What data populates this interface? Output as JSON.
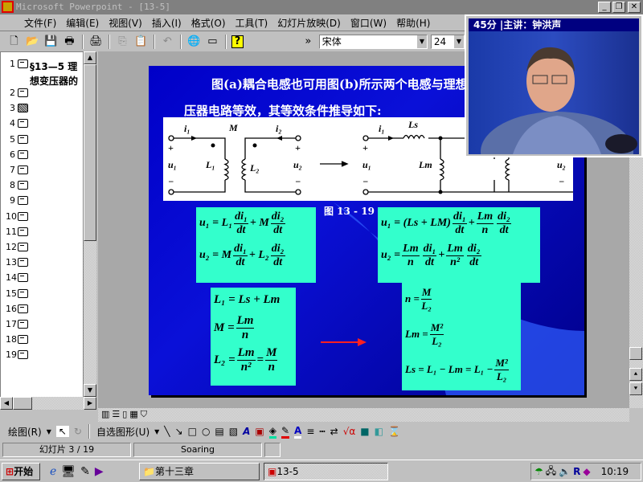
{
  "window": {
    "title": "Microsoft Powerpoint - [13-5]",
    "min": "_",
    "restore": "❐",
    "close": "✕"
  },
  "menu": [
    "文件(F)",
    "编辑(E)",
    "视图(V)",
    "插入(I)",
    "格式(O)",
    "工具(T)",
    "幻灯片放映(D)",
    "窗口(W)",
    "帮助(H)"
  ],
  "toolbar": {
    "font": "宋体",
    "size": "24",
    "more": "»"
  },
  "outline": {
    "items": [
      "1",
      "2",
      "3",
      "4",
      "5",
      "6",
      "7",
      "8",
      "9",
      "10",
      "11",
      "12",
      "13",
      "14",
      "15",
      "16",
      "17",
      "18",
      "19"
    ],
    "first_line1": "§13—5 理",
    "first_line2": "想变压器的",
    "selected": "3"
  },
  "slide": {
    "title_line1": "图(a)耦合电感也可用图(b)所示两个电感与理想变",
    "title_line2": "压器电路等效，其等效条件推导如下:",
    "caption": "图 13 - 19",
    "diagram": {
      "i1": "i₁",
      "i2": "i₂",
      "M": "M",
      "L1": "L₁",
      "L2": "L₂",
      "u1": "u₁",
      "u2": "u₂",
      "plus": "+",
      "minus": "−",
      "Ls": "Ls",
      "Lm": "Lm"
    },
    "eq_left": {
      "l1_a": "u₁ = L₁",
      "di1": "di₁",
      "dt": "dt",
      "plusM": "+ M",
      "di2": "di₂",
      "l2_a": "u₂ = M",
      "plusL2": "+ L₂"
    },
    "eq_right": {
      "l1_a": "u₁ = (Ls + LM)",
      "plus": "+",
      "Lm": "Lm",
      "n": "n",
      "n2": "n²",
      "l2_a": "u₂ =",
      "di1": "di₁",
      "di2": "di₂",
      "dt": "dt"
    },
    "cond_left": {
      "c1": "L₁ = Ls + Lm",
      "c2_a": "M =",
      "Lm": "Lm",
      "n": "n",
      "c3_a": "L₂ =",
      "n2": "n²",
      "eq": "=",
      "M": "M"
    },
    "cond_right": {
      "c1_a": "n =",
      "M": "M",
      "L2": "L₂",
      "c2_a": "Lm =",
      "M2": "M²",
      "c3_a": "Ls = L₁ − Lm = L₁ −"
    },
    "arrow_color": "#ff2020",
    "box_color": "#33ffcc"
  },
  "video": {
    "title": "45分 |主讲：钟洪声"
  },
  "drawbar": {
    "draw": "绘图(R)",
    "autoshapes": "自选图形(U)"
  },
  "status": {
    "slide": "幻灯片 3 / 19",
    "design": "Soaring"
  },
  "taskbar": {
    "start": "开始",
    "task1": "第十三章",
    "task2": "13-5",
    "clock": "10:19"
  }
}
